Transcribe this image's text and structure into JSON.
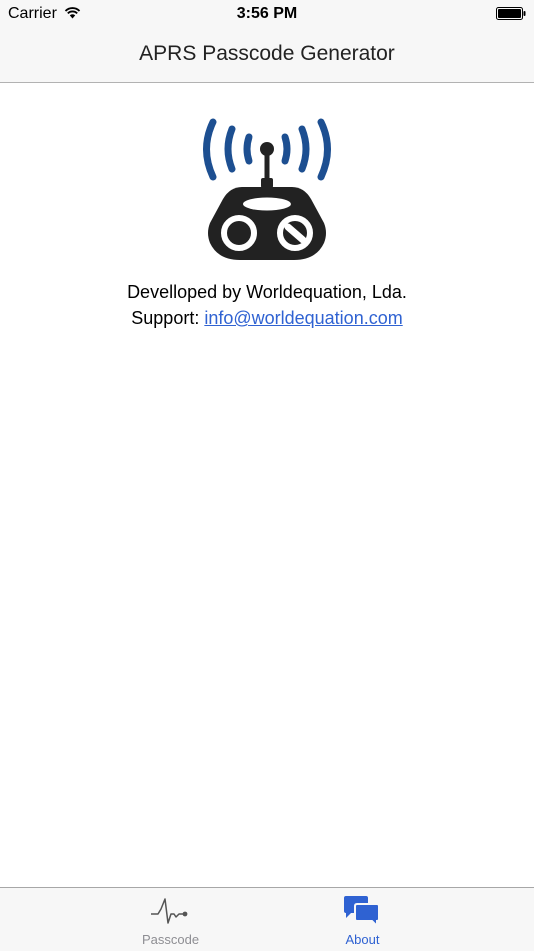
{
  "status_bar": {
    "carrier": "Carrier",
    "time": "3:56 PM"
  },
  "nav": {
    "title": "APRS Passcode Generator"
  },
  "about": {
    "developer_text": "Develloped by Worldequation, Lda.",
    "support_label": "Support: ",
    "support_email": "info@worldequation.com"
  },
  "tabs": [
    {
      "label": "Passcode",
      "icon": "waveform-icon",
      "selected": false
    },
    {
      "label": "About",
      "icon": "chat-bubbles-icon",
      "selected": true
    }
  ],
  "colors": {
    "accent": "#2f62d2",
    "logo_waves": "#1d4f91",
    "logo_body": "#222222",
    "tab_inactive": "#8e8e93"
  }
}
